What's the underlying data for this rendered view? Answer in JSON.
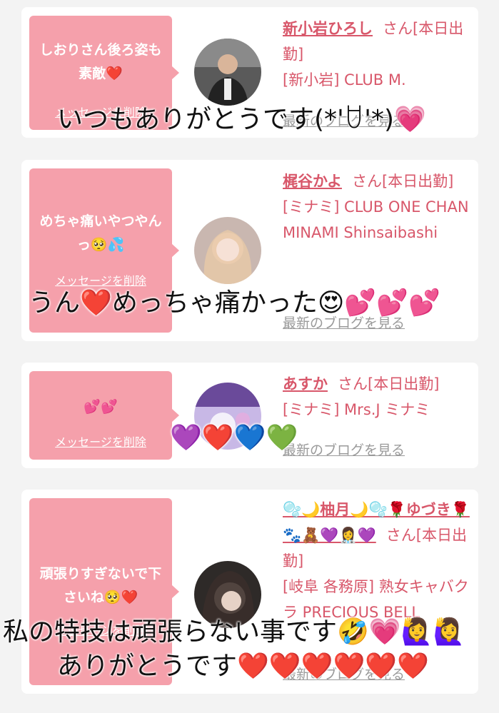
{
  "messages": [
    {
      "bubble": "しおりさん後ろ姿も素敵❤️",
      "delete": "メッセージを削除",
      "name": "新小岩ひろし",
      "san": "さん[本日出勤]",
      "shop": "[新小岩] CLUB M.",
      "blog": "最新のブログを見る",
      "overlay": "いつもありがとうです(*'ꇴ'*)💗"
    },
    {
      "bubble": "めちゃ痛いやつやんっ🥺💦",
      "delete": "メッセージを削除",
      "name": "梶谷かよ",
      "san": "さん[本日出勤]",
      "shop": "[ミナミ] CLUB ONE CHAN MINAMI Shinsaibashi",
      "blog": "最新のブログを見る",
      "overlay": "うん❤️めっちゃ痛かった😍💕💕💕"
    },
    {
      "bubble": "💕💕",
      "delete": "メッセージを削除",
      "name": "あすか",
      "san": "さん[本日出勤]",
      "shop": "[ミナミ] Mrs.J ミナミ",
      "blog": "最新のブログを見る",
      "overlay": "💜❤️💙💚"
    },
    {
      "bubble": "頑張りすぎないで下さいね🥺❤️",
      "delete": "メッセージを削除",
      "name": "🫧🌙柚月🌙🫧🌹ゆづき🌹🐾🧸💜👩‍⚕️💜",
      "san": "さん[本日出勤]",
      "shop": "[岐阜 各務原] 熟女キャバクラ PRECIOUS BELL",
      "blog": "最新のブログを見る",
      "overlay_line1": "私の特技は頑張らない事です🤣💗🙋‍♀️🙋‍♀️",
      "overlay_line2": "ありがとうです❤️❤️❤️❤️❤️❤️"
    }
  ],
  "colors": {
    "bubble": "#f5a0ab",
    "name": "#d8576a",
    "blog": "#9a9a9a"
  }
}
